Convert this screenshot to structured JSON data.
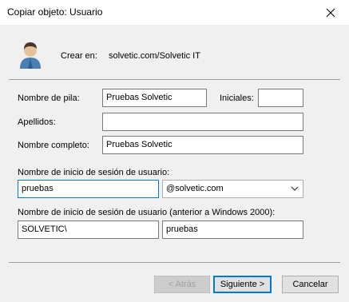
{
  "window": {
    "title": "Copiar objeto: Usuario",
    "close_icon": "close-icon"
  },
  "header": {
    "user_icon": "user-icon",
    "create_in_label": "Crear en:",
    "create_in_value": "solvetic.com/Solvetic IT"
  },
  "form": {
    "first_name": {
      "label": "Nombre de pila:",
      "value": "Pruebas Solvetic"
    },
    "initials": {
      "label": "Iniciales:",
      "value": ""
    },
    "last_name": {
      "label": "Apellidos:",
      "value": ""
    },
    "full_name": {
      "label": "Nombre completo:",
      "value": "Pruebas Solvetic"
    },
    "logon": {
      "label": "Nombre de inicio de sesión de usuario:",
      "value": "pruebas",
      "domain": "@solvetic.com"
    },
    "pre2000": {
      "label": "Nombre de inicio de sesión de usuario (anterior a Windows 2000):",
      "domain": "SOLVETIC\\",
      "value": "pruebas"
    }
  },
  "buttons": {
    "back": "< Atrás",
    "next": "Siguiente >",
    "cancel": "Cancelar"
  },
  "colors": {
    "accent": "#0078d7",
    "background": "#f0f0f0"
  }
}
